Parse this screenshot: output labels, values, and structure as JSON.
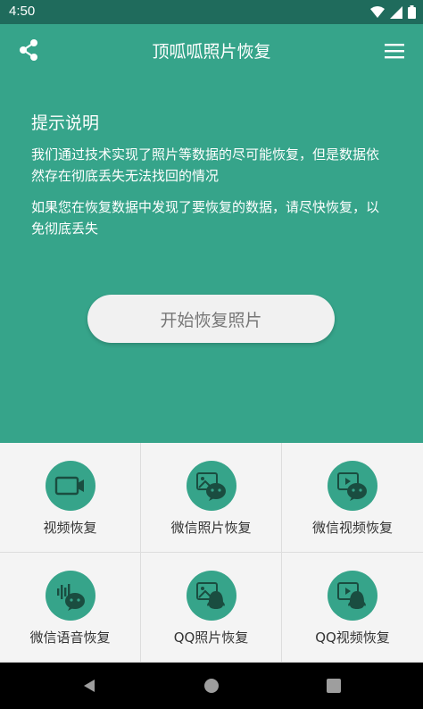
{
  "status_bar": {
    "time": "4:50"
  },
  "header": {
    "title": "顶呱呱照片恢复"
  },
  "tips": {
    "title": "提示说明",
    "paragraph1": "我们通过技术实现了照片等数据的尽可能恢复，但是数据依然存在彻底丢失无法找回的情况",
    "paragraph2": "如果您在恢复数据中发现了要恢复的数据，请尽快恢复，以免彻底丢失"
  },
  "start_button": {
    "label": "开始恢复照片"
  },
  "grid": {
    "items": [
      {
        "label": "视频恢复",
        "icon": "video-camera-icon"
      },
      {
        "label": "微信照片恢复",
        "icon": "wechat-photo-icon"
      },
      {
        "label": "微信视频恢复",
        "icon": "wechat-video-icon"
      },
      {
        "label": "微信语音恢复",
        "icon": "wechat-voice-icon"
      },
      {
        "label": "QQ照片恢复",
        "icon": "qq-photo-icon"
      },
      {
        "label": "QQ视频恢复",
        "icon": "qq-video-icon"
      }
    ]
  },
  "colors": {
    "primary": "#36a48a",
    "status_bar": "#1f6b5c",
    "button_bg": "#f1f1f1"
  }
}
